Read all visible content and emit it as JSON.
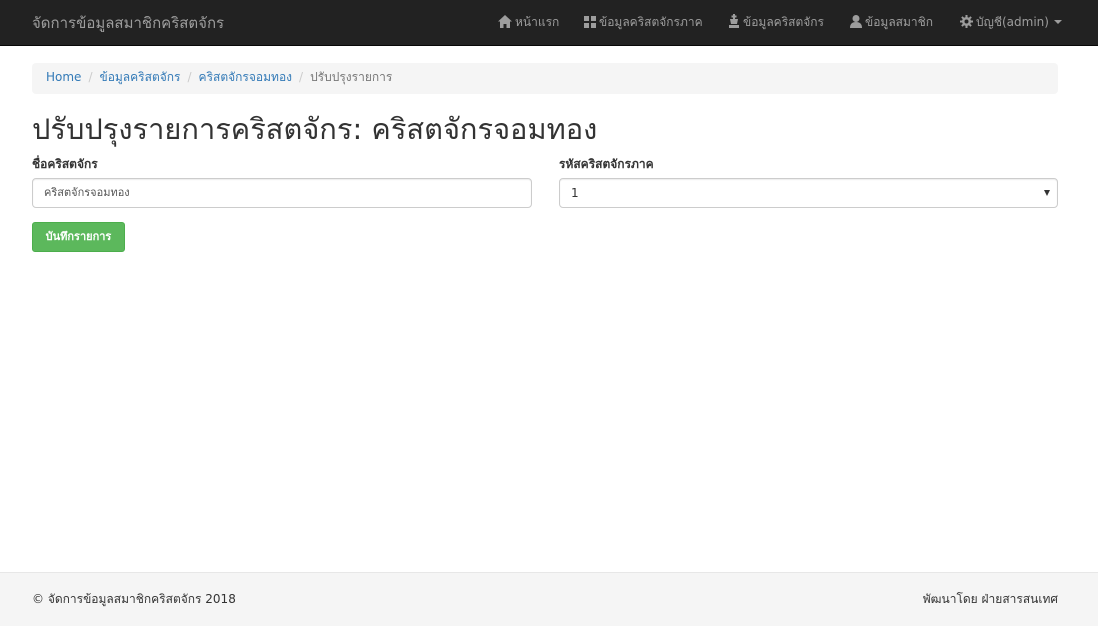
{
  "navbar": {
    "brand": "จัดการข้อมูลสมาชิกคริสตจักร",
    "items": [
      {
        "label": "หน้าแรก",
        "icon": "home-icon"
      },
      {
        "label": "ข้อมูลคริสตจักรภาค",
        "icon": "th-large-icon"
      },
      {
        "label": "ข้อมูลคริสตจักร",
        "icon": "chess-king-icon"
      },
      {
        "label": "ข้อมูลสมาชิก",
        "icon": "user-icon"
      },
      {
        "label": "บัญชี(admin)",
        "icon": "gear-icon"
      }
    ]
  },
  "breadcrumb": {
    "items": [
      "Home",
      "ข้อมูลคริสตจักร",
      "คริสตจักรจอมทอง"
    ],
    "active": "ปรับปรุงรายการ"
  },
  "page": {
    "title": "ปรับปรุงรายการคริสตจักร: คริสตจักรจอมทอง"
  },
  "form": {
    "church_name_label": "ชื่อคริสตจักร",
    "church_name_value": "คริสตจักรจอมทอง",
    "region_code_label": "รหัสคริสตจักรภาค",
    "region_code_value": "1",
    "save_label": "บันทึกรายการ"
  },
  "footer": {
    "copyright": "© จัดการข้อมูลสมาชิกคริสตจักร 2018",
    "developer": "พัฒนาโดย ฝ่ายสารสนเทศ"
  },
  "colors": {
    "navbar_bg": "#222222",
    "nav_text": "#9d9d9d",
    "link": "#337ab7",
    "success": "#5cb85c",
    "footer_bg": "#f5f5f5"
  }
}
